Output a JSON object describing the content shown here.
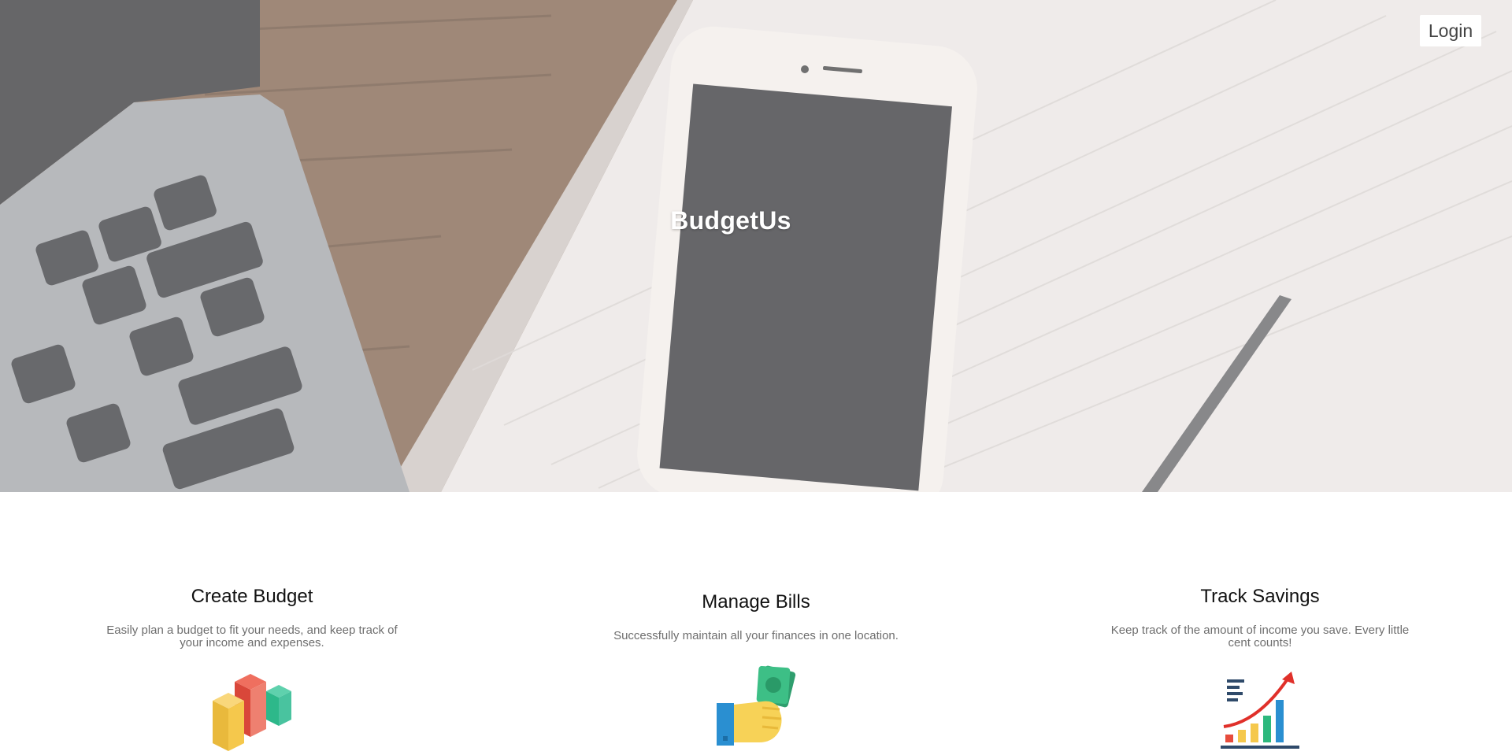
{
  "hero": {
    "brand_title": "BudgetUs",
    "login_label": "Login"
  },
  "features": [
    {
      "title": "Create Budget",
      "description": "Easily plan a budget to fit your needs, and keep track of your income and expenses.",
      "icon": "bar-blocks-icon"
    },
    {
      "title": "Manage Bills",
      "description": "Successfully maintain all your finances in one location.",
      "icon": "hand-money-icon"
    },
    {
      "title": "Track Savings",
      "description": "Keep track of the amount of income you save. Every little cent counts!",
      "icon": "growth-chart-icon"
    }
  ],
  "colors": {
    "accent_red": "#e74c3c",
    "accent_yellow": "#f5c84c",
    "accent_green": "#2db87d",
    "accent_blue": "#2a8fd1",
    "text_muted": "#6e6e6e"
  }
}
